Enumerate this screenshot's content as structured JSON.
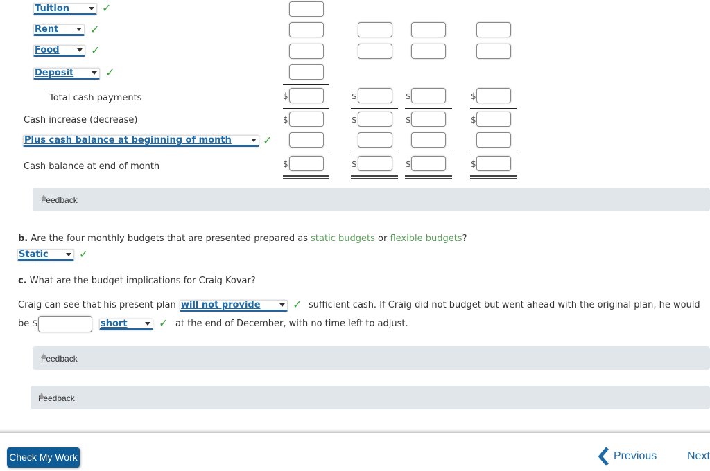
{
  "schedule": {
    "payment_selects": [
      {
        "value": "Tuition",
        "correct": true
      },
      {
        "value": "Rent",
        "correct": true
      },
      {
        "value": "Food",
        "correct": true
      },
      {
        "value": "Deposit",
        "correct": true
      }
    ],
    "rows": {
      "total_cash_payments": "Total cash payments",
      "cash_increase": "Cash increase (decrease)",
      "plus_cash_balance_select": "Plus cash balance at beginning of month",
      "cash_balance_end": "Cash balance at end of month"
    },
    "currency_symbol": "$"
  },
  "feedback_label": "Feedback",
  "part_b": {
    "letter": "b.",
    "question_prefix": "Are the four monthly budgets that are presented prepared as",
    "term1": "static budgets",
    "or": "or",
    "term2": "flexible budgets",
    "suffix": "?",
    "answer": "Static"
  },
  "part_c": {
    "letter": "c.",
    "question": "What are the budget implications for Craig Kovar?",
    "sentence1_prefix": "Craig can see that his present plan",
    "select1": "will not provide",
    "sentence1_suffix": "sufficient cash. If Craig did not budget but went ahead with the original plan, he would",
    "sentence2_prefix": "be $",
    "amount_value": "",
    "select2": "short",
    "sentence2_suffix": "at the end of December, with no time left to adjust."
  },
  "footer": {
    "check_my_work": "Check My Work",
    "previous": "Previous",
    "next": "Next"
  },
  "check_mark": "✓"
}
